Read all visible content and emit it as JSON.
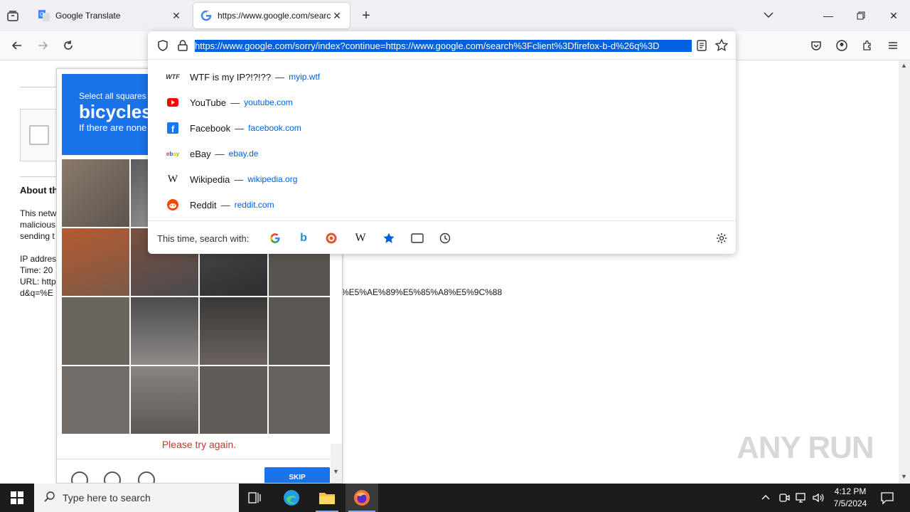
{
  "tabs": [
    {
      "title": "Google Translate",
      "icon": "google-translate-icon"
    },
    {
      "title": "https://www.google.com/searc",
      "icon": "google-g-icon"
    }
  ],
  "nav": {
    "url": "https://www.google.com/sorry/index?continue=https://www.google.com/search%3Fclient%3Dfirefox-b-d%26q%3D"
  },
  "suggestions": [
    {
      "title": "WTF is my IP?!?!??",
      "url": "myip.wtf",
      "icon": "wtf-icon",
      "color": "#333333"
    },
    {
      "title": "YouTube",
      "url": "youtube.com",
      "icon": "youtube-icon",
      "color": "#ff0000"
    },
    {
      "title": "Facebook",
      "url": "facebook.com",
      "icon": "facebook-icon",
      "color": "#1877f2"
    },
    {
      "title": "eBay",
      "url": "ebay.de",
      "icon": "ebay-icon",
      "color": "#e53238"
    },
    {
      "title": "Wikipedia",
      "url": "wikipedia.org",
      "icon": "wikipedia-icon",
      "color": "#000000"
    },
    {
      "title": "Reddit",
      "url": "reddit.com",
      "icon": "reddit-icon",
      "color": "#ff4500"
    }
  ],
  "search_with": {
    "label": "This time, search with:",
    "engines": [
      "google-icon",
      "bing-icon",
      "duckduckgo-icon",
      "wikipedia-icon",
      "bookmarks-icon",
      "tabs-icon",
      "history-icon"
    ]
  },
  "page": {
    "about_heading": "About th",
    "body_lines": [
      "This netw",
      "malicious",
      "sending t"
    ],
    "ip_line": "IP addres",
    "time_line": "Time: 20",
    "url_line": "URL: http",
    "query_line": "d&q=%E",
    "query_tail": "%E5%AE%89%E5%85%A8%E5%9C%88"
  },
  "captcha": {
    "select_text": "Select all squares",
    "keyword": "bicycles",
    "if_none": "If there are none",
    "error": "Please try again.",
    "verify": "SKIP"
  },
  "taskbar": {
    "search_placeholder": "Type here to search",
    "time": "4:12 PM",
    "date": "7/5/2024"
  },
  "watermark": "ANY RUN"
}
